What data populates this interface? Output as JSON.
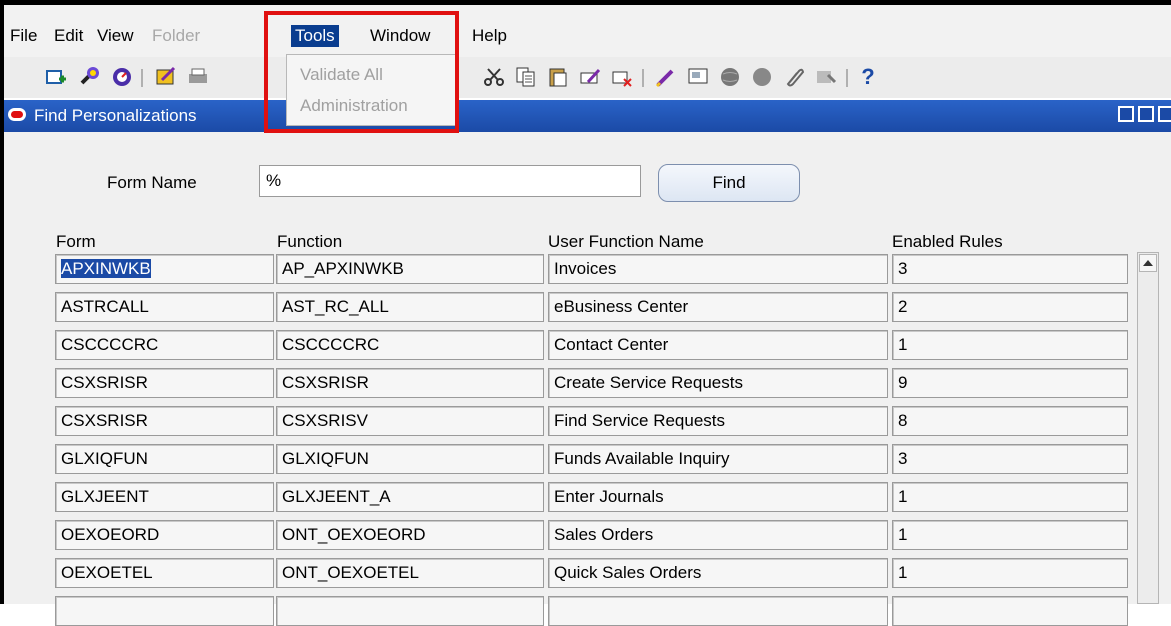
{
  "menubar": {
    "items": [
      "File",
      "Edit",
      "View",
      "Folder",
      "Tools",
      "Window",
      "Help"
    ]
  },
  "tools_menu": {
    "items": [
      "Validate All",
      "Administration"
    ]
  },
  "toolbar": {
    "help_glyph": "?"
  },
  "window": {
    "title": "Find Personalizations"
  },
  "form": {
    "form_name_label": "Form Name",
    "form_name_value": "%",
    "find_label": "Find"
  },
  "table": {
    "columns": [
      "Form",
      "Function",
      "User Function Name",
      "Enabled Rules"
    ],
    "rows": [
      {
        "form": "APXINWKB",
        "function": "AP_APXINWKB",
        "user_function": "Invoices",
        "rules": "3"
      },
      {
        "form": "ASTRCALL",
        "function": "AST_RC_ALL",
        "user_function": "eBusiness Center",
        "rules": "2"
      },
      {
        "form": "CSCCCCRC",
        "function": "CSCCCCRC",
        "user_function": "Contact Center",
        "rules": "1"
      },
      {
        "form": "CSXSRISR",
        "function": "CSXSRISR",
        "user_function": "Create Service Requests",
        "rules": "9"
      },
      {
        "form": "CSXSRISR",
        "function": "CSXSRISV",
        "user_function": "Find Service Requests",
        "rules": "8"
      },
      {
        "form": "GLXIQFUN",
        "function": "GLXIQFUN",
        "user_function": "Funds Available Inquiry",
        "rules": "3"
      },
      {
        "form": "GLXJEENT",
        "function": "GLXJEENT_A",
        "user_function": "Enter Journals",
        "rules": "1"
      },
      {
        "form": "OEXOEORD",
        "function": "ONT_OEXOEORD",
        "user_function": "Sales Orders",
        "rules": "1"
      },
      {
        "form": "OEXOETEL",
        "function": "ONT_OEXOETEL",
        "user_function": "Quick Sales Orders",
        "rules": "1"
      }
    ]
  },
  "colors": {
    "highlight_box": "#e01010",
    "title_bar": "#1b4aa6",
    "selection": "#1b4aa6"
  }
}
